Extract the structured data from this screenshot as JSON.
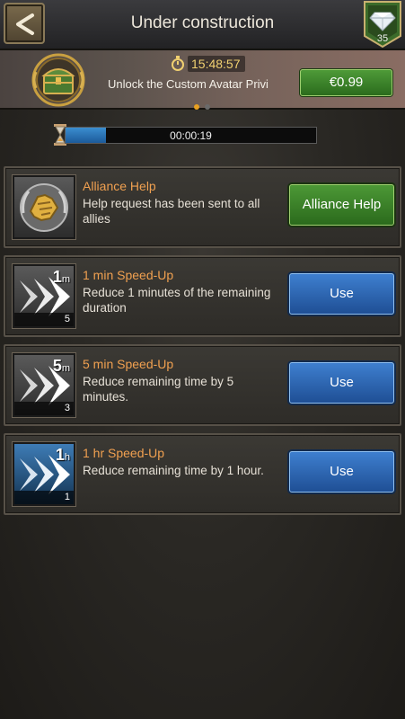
{
  "header": {
    "title": "Under construction",
    "gem_count": "35"
  },
  "promo": {
    "timer": "15:48:57",
    "text": "Unlock the Custom Avatar Privi",
    "price": "€0.99"
  },
  "progress": {
    "time": "00:00:19",
    "fraction": 0.16
  },
  "cards": [
    {
      "title": "Alliance Help",
      "desc": "Help request has been sent to all allies",
      "button": "Alliance Help",
      "icon": "handshake-icon"
    },
    {
      "title": "1 min Speed-Up",
      "desc": "Reduce 1 minutes of the remaining duration",
      "button": "Use",
      "tag_num": "1",
      "tag_unit": "m",
      "qty": "5",
      "icon": "arrows-speedup-icon"
    },
    {
      "title": "5 min Speed-Up",
      "desc": "Reduce remaining time by 5 minutes.",
      "button": "Use",
      "tag_num": "5",
      "tag_unit": "m",
      "qty": "3",
      "icon": "arrows-speedup-icon"
    },
    {
      "title": "1 hr Speed-Up",
      "desc": "Reduce remaining time by 1 hour.",
      "button": "Use",
      "tag_num": "1",
      "tag_unit": "h",
      "qty": "1",
      "icon": "arrows-speedup-icon"
    }
  ],
  "colors": {
    "accent_orange": "#f0a050",
    "timer_gold": "#f0d070",
    "green_button": "#3f8a2c",
    "blue_button": "#2f67b2"
  }
}
